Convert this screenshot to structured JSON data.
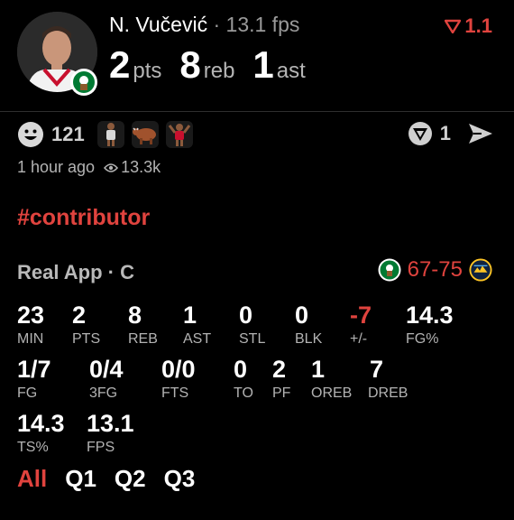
{
  "header": {
    "player_name": "N. Vučević",
    "dot": " · ",
    "fps": "13.1 fps",
    "vote": "1.1",
    "statline": [
      {
        "value": "2",
        "unit": "pts"
      },
      {
        "value": "8",
        "unit": "reb"
      },
      {
        "value": "1",
        "unit": "ast"
      }
    ]
  },
  "social": {
    "reaction_count": "121",
    "reactions": [
      "player-silhouette",
      "bull",
      "player-dunk"
    ],
    "vote_count": "1",
    "time_ago": "1 hour ago",
    "views": "13.3k"
  },
  "hashtag": "#contributor",
  "game": {
    "title": "Real App · C",
    "score": "67-75"
  },
  "stats": [
    {
      "value": "23",
      "label": "MIN"
    },
    {
      "value": "2",
      "label": "PTS"
    },
    {
      "value": "8",
      "label": "REB"
    },
    {
      "value": "1",
      "label": "AST"
    },
    {
      "value": "0",
      "label": "STL"
    },
    {
      "value": "0",
      "label": "BLK"
    },
    {
      "value": "-7",
      "label": "+/-"
    },
    {
      "value": "14.3",
      "label": "FG%"
    },
    {
      "value": "1/7",
      "label": "FG"
    },
    {
      "value": "0/4",
      "label": "3FG"
    },
    {
      "value": "0/0",
      "label": "FTS"
    },
    {
      "value": "0",
      "label": "TO"
    },
    {
      "value": "2",
      "label": "PF"
    },
    {
      "value": "1",
      "label": "OREB"
    },
    {
      "value": "7",
      "label": "DREB"
    },
    {
      "value": "14.3",
      "label": "TS%"
    },
    {
      "value": "13.1",
      "label": "FPS"
    }
  ],
  "tabs": [
    "All",
    "Q1",
    "Q2",
    "Q3"
  ],
  "colors": {
    "accent": "#e0433e",
    "celtics": "#007a33",
    "nuggets_gold": "#fec524"
  }
}
